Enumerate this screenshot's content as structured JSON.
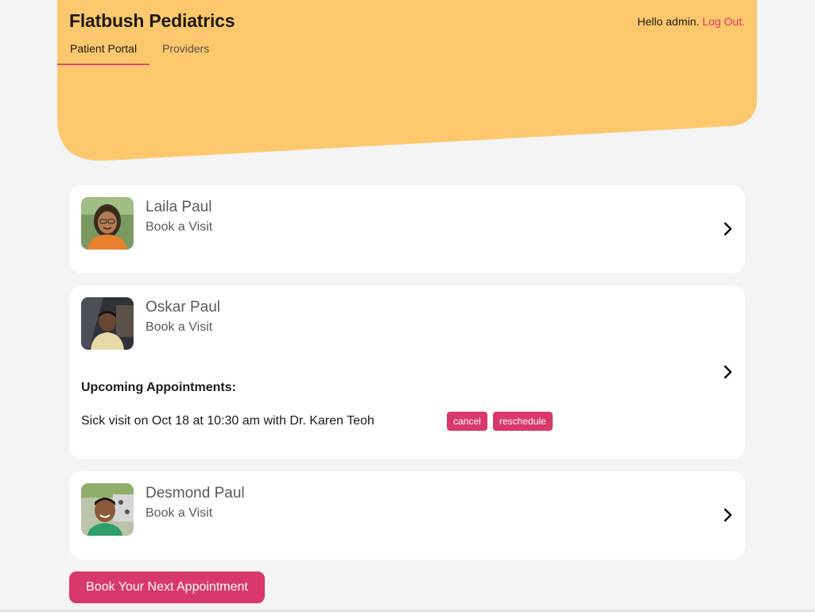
{
  "colors": {
    "header_bg": "#fdc86d",
    "accent": "#d9386a",
    "card_bg": "#ffffff",
    "page_bg": "#f4f4f4"
  },
  "header": {
    "brand": "Flatbush Pediatrics",
    "greeting": "Hello admin.",
    "logout_label": "Log Out.",
    "tabs": [
      {
        "label": "Patient Portal",
        "active": true
      },
      {
        "label": "Providers",
        "active": false
      }
    ]
  },
  "children": [
    {
      "name": "Laila Paul",
      "action": "Book a Visit",
      "chevron_icon": "chevron-right-icon"
    },
    {
      "name": "Oskar Paul",
      "action": "Book a Visit",
      "chevron_icon": "chevron-right-icon",
      "appointments_heading": "Upcoming Appointments:",
      "appointments": [
        {
          "text": "Sick visit on Oct 18 at 10:30 am with Dr. Karen Teoh",
          "cancel_label": "cancel",
          "reschedule_label": "reschedule"
        }
      ]
    },
    {
      "name": "Desmond Paul",
      "action": "Book a Visit",
      "chevron_icon": "chevron-right-icon"
    }
  ],
  "cta_label": "Book Your Next Appointment"
}
